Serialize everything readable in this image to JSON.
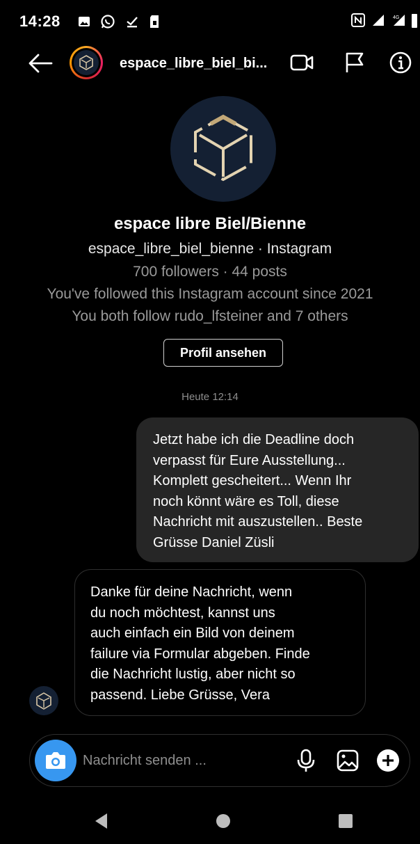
{
  "status_bar": {
    "time": "14:28",
    "left_icons": [
      "gallery-icon",
      "whatsapp-icon",
      "download-done-icon",
      "sim-icon"
    ],
    "right_icons": [
      "nfc-icon",
      "signal-icon",
      "signal-4g-icon",
      "battery-icon"
    ]
  },
  "header": {
    "title": "espace_libre_biel_bi...",
    "icons": [
      "back-arrow-icon",
      "video-call-icon",
      "flag-icon",
      "info-icon"
    ]
  },
  "profile": {
    "name": "espace libre Biel/Bienne",
    "handle_line": "espace_libre_biel_bienne · Instagram",
    "stats": "700 followers · 44 posts",
    "followed_since": "You've followed this Instagram account since 2021",
    "mutual": "You both follow rudo_lfsteiner and 7 others",
    "button_label": "Profil ansehen"
  },
  "timestamp": "Heute 12:14",
  "messages": [
    {
      "direction": "outgoing",
      "lines": [
        "Jetzt habe ich die Deadline doch",
        "verpasst für Eure Ausstellung...",
        "Komplett gescheitert... Wenn Ihr",
        "noch könnt wäre es Toll, diese",
        "Nachricht mit auszustellen.. Beste",
        "Grüsse Daniel Züsli"
      ]
    },
    {
      "direction": "incoming",
      "lines": [
        "Danke für deine Nachricht, wenn",
        "du noch möchtest, kannst uns",
        "auch einfach ein Bild von deinem",
        "failure via Formular abgeben. Finde",
        "die Nachricht lustig, aber nicht so",
        "passend. Liebe Grüsse, Vera"
      ]
    }
  ],
  "composer": {
    "placeholder": "Nachricht senden ...",
    "value": "",
    "icons": [
      "camera-icon",
      "microphone-icon",
      "gallery-icon",
      "plus-icon"
    ]
  },
  "nav_bar": {
    "icons": [
      "back-triangle-icon",
      "home-circle-icon",
      "recents-square-icon"
    ]
  },
  "colors": {
    "background": "#000000",
    "outgoing_bubble": "#262626",
    "camera_button": "#3797f0",
    "secondary_text": "#9a9a9a",
    "avatar_bg": "#142033"
  }
}
